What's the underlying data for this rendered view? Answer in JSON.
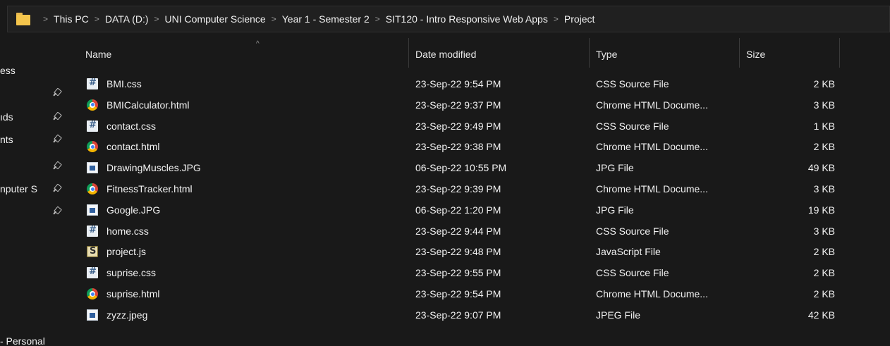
{
  "breadcrumb": [
    "This PC",
    "DATA (D:)",
    "UNI Computer Science",
    "Year 1 - Semester 2",
    "SIT120 - Intro Responsive Web Apps",
    "Project"
  ],
  "nav": [
    {
      "label": "ess",
      "pinned": false
    },
    {
      "label": "",
      "pinned": true
    },
    {
      "label": "ıds",
      "pinned": true
    },
    {
      "label": "nts",
      "pinned": true
    },
    {
      "label": "",
      "pinned": true
    },
    {
      "label": "nputer S",
      "pinned": true
    },
    {
      "label": "",
      "pinned": true
    },
    {
      "label": "- Personal",
      "pinned": false
    }
  ],
  "columns": {
    "name": "Name",
    "date": "Date modified",
    "type": "Type",
    "size": "Size"
  },
  "files": [
    {
      "name": "BMI.css",
      "date": "23-Sep-22 9:54 PM",
      "type": "CSS Source File",
      "size": "2 KB",
      "icon": "css-file-icon"
    },
    {
      "name": "BMICalculator.html",
      "date": "23-Sep-22 9:37 PM",
      "type": "Chrome HTML Docume...",
      "size": "3 KB",
      "icon": "chrome-html-icon"
    },
    {
      "name": "contact.css",
      "date": "23-Sep-22 9:49 PM",
      "type": "CSS Source File",
      "size": "1 KB",
      "icon": "css-file-icon"
    },
    {
      "name": "contact.html",
      "date": "23-Sep-22 9:38 PM",
      "type": "Chrome HTML Docume...",
      "size": "2 KB",
      "icon": "chrome-html-icon"
    },
    {
      "name": "DrawingMuscles.JPG",
      "date": "06-Sep-22 10:55 PM",
      "type": "JPG File",
      "size": "49 KB",
      "icon": "image-file-icon"
    },
    {
      "name": "FitnessTracker.html",
      "date": "23-Sep-22 9:39 PM",
      "type": "Chrome HTML Docume...",
      "size": "3 KB",
      "icon": "chrome-html-icon"
    },
    {
      "name": "Google.JPG",
      "date": "06-Sep-22 1:20 PM",
      "type": "JPG File",
      "size": "19 KB",
      "icon": "image-file-icon"
    },
    {
      "name": "home.css",
      "date": "23-Sep-22 9:44 PM",
      "type": "CSS Source File",
      "size": "3 KB",
      "icon": "css-file-icon"
    },
    {
      "name": "project.js",
      "date": "23-Sep-22 9:48 PM",
      "type": "JavaScript File",
      "size": "2 KB",
      "icon": "js-file-icon"
    },
    {
      "name": "suprise.css",
      "date": "23-Sep-22 9:55 PM",
      "type": "CSS Source File",
      "size": "2 KB",
      "icon": "css-file-icon"
    },
    {
      "name": "suprise.html",
      "date": "23-Sep-22 9:54 PM",
      "type": "Chrome HTML Docume...",
      "size": "2 KB",
      "icon": "chrome-html-icon"
    },
    {
      "name": "zyzz.jpeg",
      "date": "23-Sep-22 9:07 PM",
      "type": "JPEG File",
      "size": "42 KB",
      "icon": "image-file-icon"
    }
  ]
}
